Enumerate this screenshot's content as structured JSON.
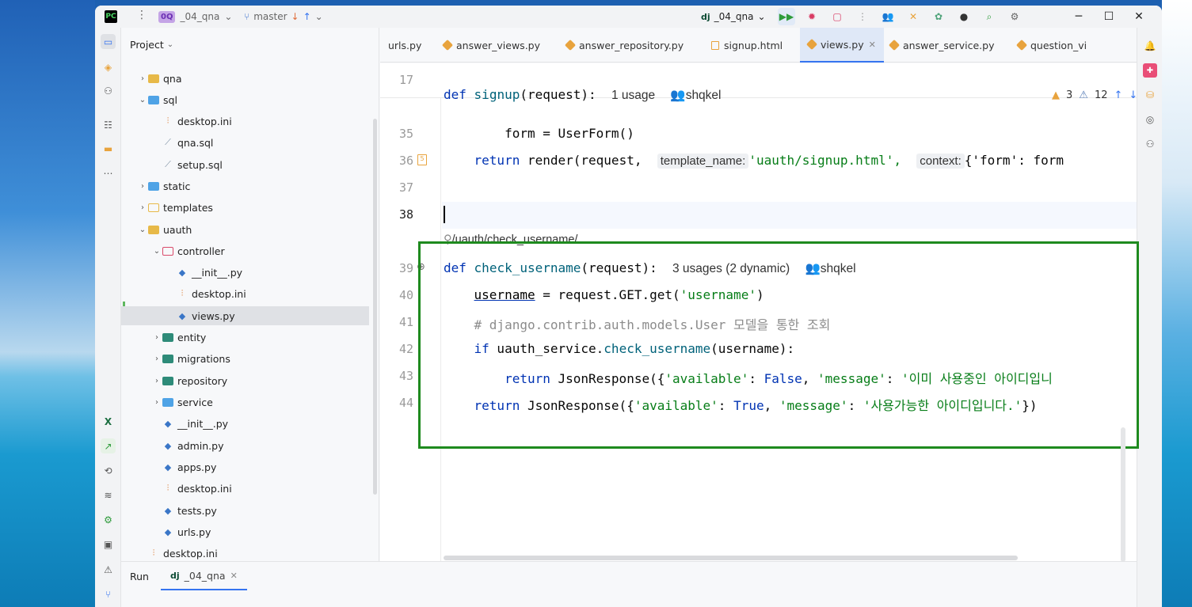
{
  "titlebar": {
    "project_badge": "0Q",
    "project_name": "_04_qna",
    "branch": "master",
    "run_config": "_04_qna"
  },
  "project_panel": {
    "title": "Project",
    "items": [
      {
        "label": "qna",
        "kind": "folder",
        "state": "collapsed"
      },
      {
        "label": "sql",
        "kind": "folder-blue",
        "state": "expanded"
      },
      {
        "label": "desktop.ini",
        "kind": "ini"
      },
      {
        "label": "qna.sql",
        "kind": "sql"
      },
      {
        "label": "setup.sql",
        "kind": "sql"
      },
      {
        "label": "static",
        "kind": "folder-blue",
        "state": "collapsed"
      },
      {
        "label": "templates",
        "kind": "folder-outline",
        "state": "collapsed"
      },
      {
        "label": "uauth",
        "kind": "folder",
        "state": "expanded"
      },
      {
        "label": "controller",
        "kind": "folder-red",
        "state": "expanded"
      },
      {
        "label": "__init__.py",
        "kind": "py"
      },
      {
        "label": "desktop.ini",
        "kind": "ini"
      },
      {
        "label": "views.py",
        "kind": "py",
        "selected": true
      },
      {
        "label": "entity",
        "kind": "folder-teal",
        "state": "collapsed"
      },
      {
        "label": "migrations",
        "kind": "folder-teal",
        "state": "collapsed"
      },
      {
        "label": "repository",
        "kind": "folder-teal",
        "state": "collapsed"
      },
      {
        "label": "service",
        "kind": "folder-blue",
        "state": "collapsed"
      },
      {
        "label": "__init__.py",
        "kind": "py"
      },
      {
        "label": "admin.py",
        "kind": "py"
      },
      {
        "label": "apps.py",
        "kind": "py"
      },
      {
        "label": "desktop.ini",
        "kind": "ini"
      },
      {
        "label": "tests.py",
        "kind": "py"
      },
      {
        "label": "urls.py",
        "kind": "py"
      },
      {
        "label": "desktop.ini",
        "kind": "ini"
      }
    ]
  },
  "tabs": [
    {
      "label": "urls.py"
    },
    {
      "label": "answer_views.py"
    },
    {
      "label": "answer_repository.py"
    },
    {
      "label": "signup.html"
    },
    {
      "label": "views.py",
      "active": true
    },
    {
      "label": "answer_service.py"
    },
    {
      "label": "question_vi"
    }
  ],
  "editor": {
    "sticky": {
      "line": "17",
      "usage": "1 usage",
      "author": "shqkel"
    },
    "inspections": {
      "warnings": "3",
      "weak_warnings": "12"
    },
    "lines": [
      {
        "n": "35"
      },
      {
        "n": "36"
      },
      {
        "n": "37"
      },
      {
        "n": "38"
      },
      {
        "n": "39"
      },
      {
        "n": "40"
      },
      {
        "n": "41"
      },
      {
        "n": "42"
      },
      {
        "n": "43"
      },
      {
        "n": "44"
      }
    ],
    "url_hint": "/uauth/check_username/",
    "usage_39": "3 usages (2 dynamic)",
    "author_39": "shqkel",
    "hint_template_name": "template_name:",
    "hint_context": "context:",
    "code": {
      "l17_def": "def",
      "l17_fn": "signup",
      "l17_rest": "(request):",
      "l35": "form = UserForm()",
      "l36_kw": "return",
      "l36_a": "render(request,",
      "l36_str": "'uauth/signup.html',",
      "l36_b": "{'form': form",
      "l39_def": "def",
      "l39_fn": "check_username",
      "l39_rest": "(request):",
      "l40_var": "username",
      "l40_rest": " = request.GET.get(",
      "l40_str": "'username'",
      "l40_end": ")",
      "l41": "# django.contrib.auth.models.User 모델을 통한 조회",
      "l42_kw": "if",
      "l42_a": " uauth_service.",
      "l42_fn": "check_username",
      "l42_b": "(username):",
      "l43_kw": "return",
      "l43_a": " JsonResponse({",
      "l43_k1": "'available'",
      "l43_b": ": ",
      "l43_kw2": "False",
      "l43_c": ", ",
      "l43_k2": "'message'",
      "l43_d": ": ",
      "l43_v": "'이미 사용중인 아이디입니",
      "l44_kw": "return",
      "l44_a": " JsonResponse({",
      "l44_k1": "'available'",
      "l44_b": ": ",
      "l44_kw2": "True",
      "l44_c": ", ",
      "l44_k2": "'message'",
      "l44_d": ": ",
      "l44_v": "'사용가능한 아이디입니다.'",
      "l44_end": "})"
    }
  },
  "bottom": {
    "run_label": "Run",
    "run_tab": "_04_qna"
  },
  "colors": {
    "accent": "#3574f0",
    "highlight_box": "#1e8a1e"
  }
}
